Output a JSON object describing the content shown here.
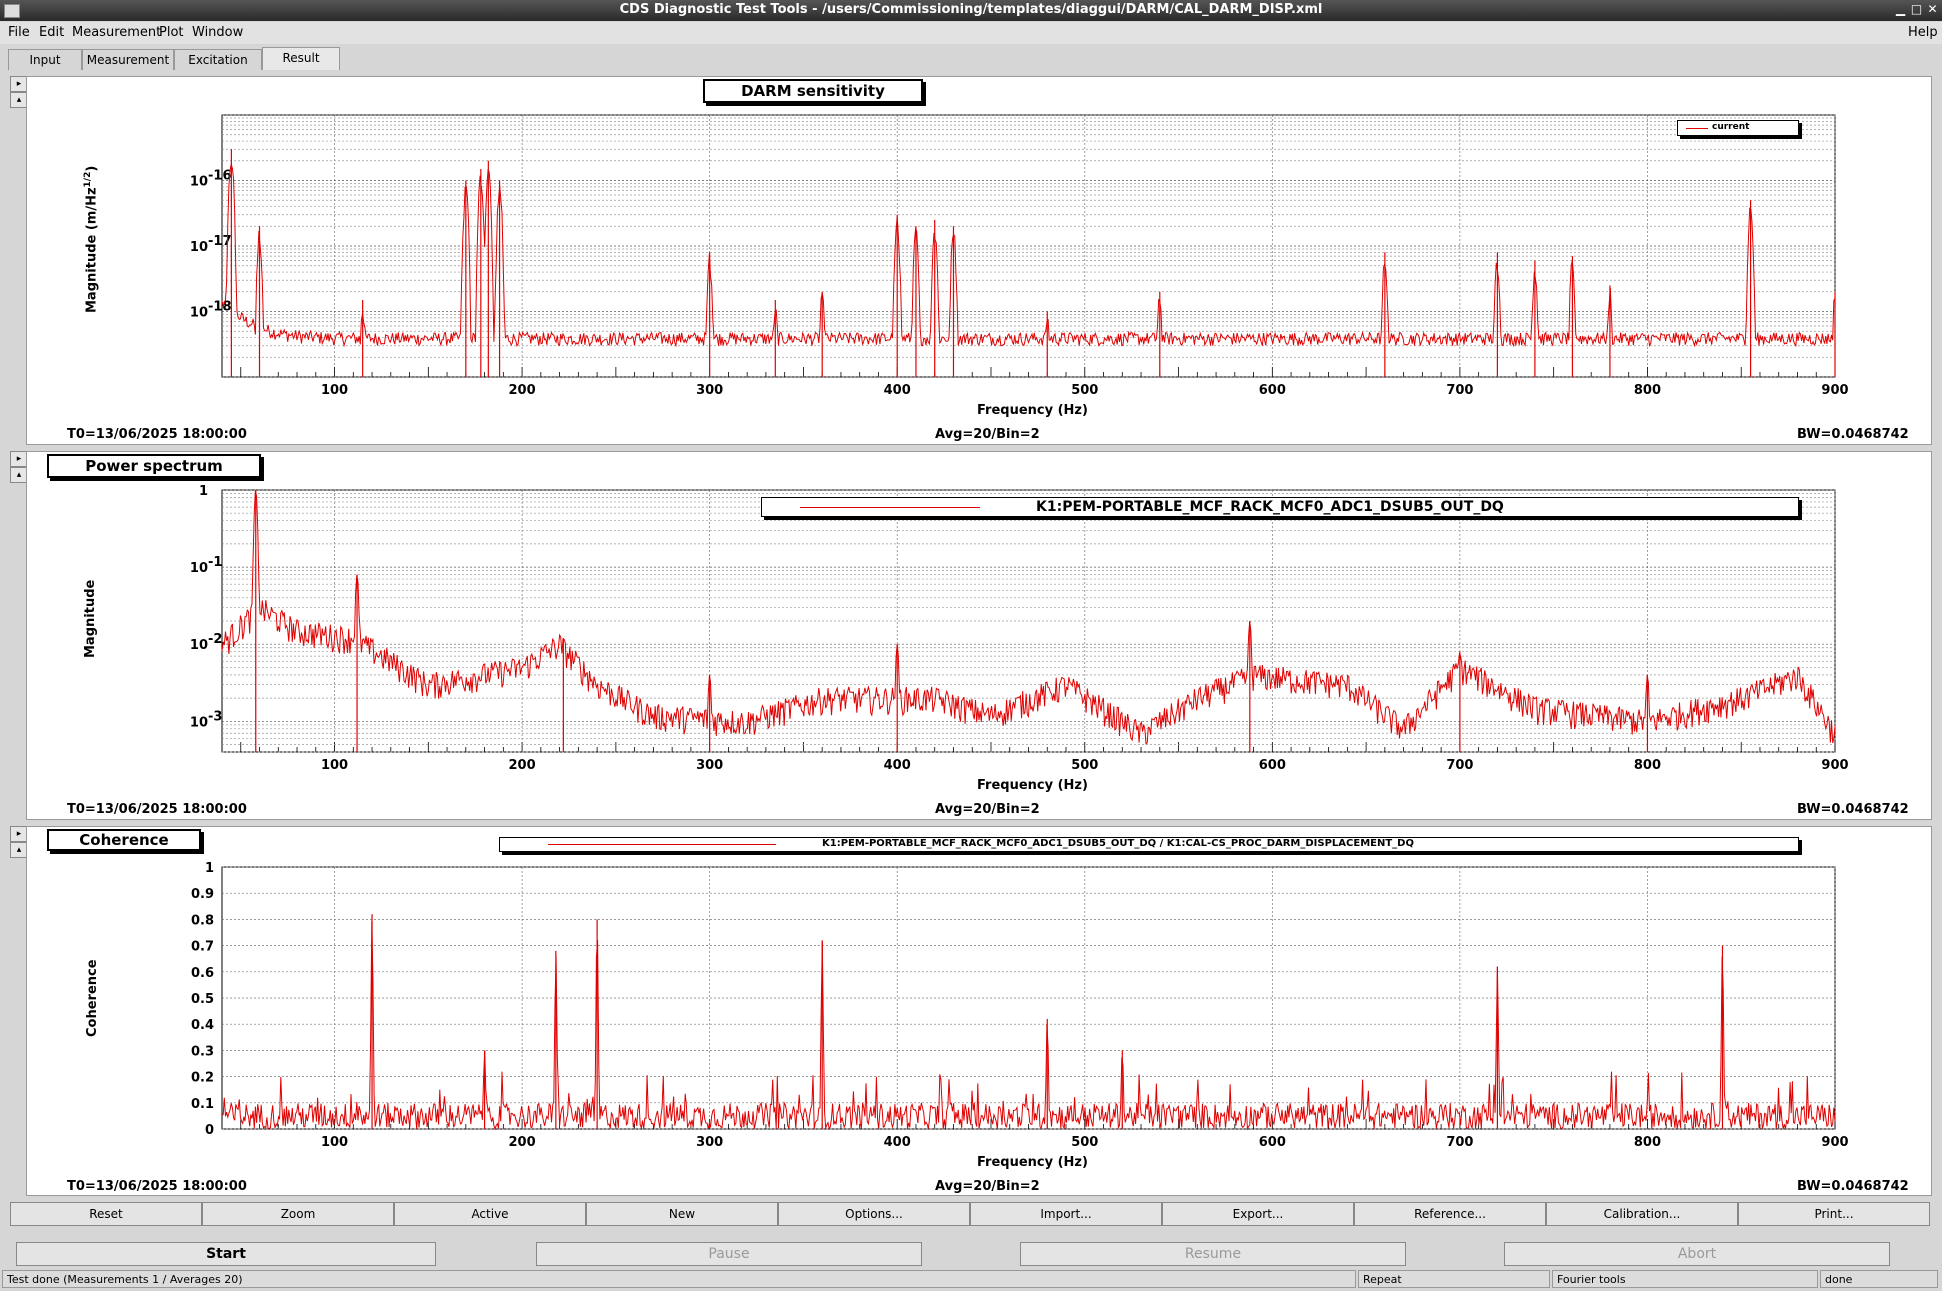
{
  "window": {
    "title": "CDS Diagnostic Test Tools - /users/Commissioning/templates/diaggui/DARM/CAL_DARM_DISP.xml"
  },
  "menu": {
    "items": [
      "File",
      "Edit",
      "Measurement",
      "Plot",
      "Window"
    ],
    "help": "Help"
  },
  "tabs": [
    "Input",
    "Measurement",
    "Excitation",
    "Result"
  ],
  "graphs": [
    {
      "title": "DARM sensitivity",
      "ylabel_main": "Magnitude (m/Hz",
      "ylabel_sup": "1/2",
      "ylabel_end": ")",
      "xlabel": "Frequency (Hz)",
      "legend": "current",
      "t0": "T0=13/06/2025 18:00:00",
      "avg": "Avg=20/Bin=2",
      "bw": "BW=0.0468742",
      "yticks": [
        {
          "base": "10",
          "exp": "-16"
        },
        {
          "base": "10",
          "exp": "-17"
        },
        {
          "base": "10",
          "exp": "-18"
        }
      ]
    },
    {
      "title": "Power spectrum",
      "ylabel_main": "Magnitude",
      "xlabel": "Frequency (Hz)",
      "legend": "K1:PEM-PORTABLE_MCF_RACK_MCF0_ADC1_DSUB5_OUT_DQ",
      "t0": "T0=13/06/2025 18:00:00",
      "avg": "Avg=20/Bin=2",
      "bw": "BW=0.0468742",
      "yticks": [
        {
          "base": "1",
          "exp": ""
        },
        {
          "base": "10",
          "exp": "-1"
        },
        {
          "base": "10",
          "exp": "-2"
        },
        {
          "base": "10",
          "exp": "-3"
        }
      ]
    },
    {
      "title": "Coherence",
      "ylabel_main": "Coherence",
      "xlabel": "Frequency (Hz)",
      "legend": "K1:PEM-PORTABLE_MCF_RACK_MCF0_ADC1_DSUB5_OUT_DQ / K1:CAL-CS_PROC_DARM_DISPLACEMENT_DQ",
      "t0": "T0=13/06/2025 18:00:00",
      "avg": "Avg=20/Bin=2",
      "bw": "BW=0.0468742",
      "yticks": [
        "1",
        "0.9",
        "0.8",
        "0.7",
        "0.6",
        "0.5",
        "0.4",
        "0.3",
        "0.2",
        "0.1",
        "0"
      ]
    }
  ],
  "xticks": [
    "100",
    "200",
    "300",
    "400",
    "500",
    "600",
    "700",
    "800",
    "900"
  ],
  "chart_data": [
    {
      "type": "line",
      "title": "DARM sensitivity",
      "xlabel": "Frequency (Hz)",
      "ylabel": "Magnitude (m/Hz^1/2)",
      "xlim": [
        40,
        900
      ],
      "ylim": [
        1e-19,
        1e-15
      ],
      "yscale": "log",
      "grid": true,
      "legend_position": "top-right",
      "series": [
        {
          "name": "current",
          "color": "#e00000",
          "baseline_floor": 3e-19,
          "peaks": [
            [
              45,
              3e-16
            ],
            [
              60,
              2e-17
            ],
            [
              115,
              1.5e-18
            ],
            [
              170,
              1e-16
            ],
            [
              178,
              1.5e-16
            ],
            [
              182,
              2e-16
            ],
            [
              188,
              1e-16
            ],
            [
              300,
              8e-18
            ],
            [
              335,
              1.5e-18
            ],
            [
              360,
              2e-18
            ],
            [
              400,
              3e-17
            ],
            [
              410,
              2e-17
            ],
            [
              420,
              2.5e-17
            ],
            [
              430,
              2e-17
            ],
            [
              480,
              1e-18
            ],
            [
              540,
              2e-18
            ],
            [
              660,
              8e-18
            ],
            [
              720,
              8e-18
            ],
            [
              740,
              6e-18
            ],
            [
              760,
              7e-18
            ],
            [
              780,
              2.5e-18
            ],
            [
              855,
              5e-17
            ],
            [
              900,
              2e-18
            ]
          ]
        }
      ]
    },
    {
      "type": "line",
      "title": "Power spectrum",
      "xlabel": "Frequency (Hz)",
      "ylabel": "Magnitude",
      "xlim": [
        40,
        900
      ],
      "ylim": [
        0.0004,
        1
      ],
      "yscale": "log",
      "grid": true,
      "legend_position": "top-right",
      "series": [
        {
          "name": "K1:PEM-PORTABLE_MCF_RACK_MCF0_ADC1_DSUB5_OUT_DQ",
          "color": "#e00000",
          "trend": [
            [
              40,
              0.01
            ],
            [
              60,
              0.03
            ],
            [
              80,
              0.015
            ],
            [
              110,
              0.012
            ],
            [
              150,
              0.003
            ],
            [
              200,
              0.005
            ],
            [
              220,
              0.01
            ],
            [
              240,
              0.003
            ],
            [
              270,
              0.0012
            ],
            [
              320,
              0.001
            ],
            [
              360,
              0.002
            ],
            [
              420,
              0.002
            ],
            [
              450,
              0.0012
            ],
            [
              490,
              0.003
            ],
            [
              530,
              0.0007
            ],
            [
              560,
              0.002
            ],
            [
              590,
              0.004
            ],
            [
              640,
              0.003
            ],
            [
              670,
              0.0008
            ],
            [
              700,
              0.005
            ],
            [
              740,
              0.0015
            ],
            [
              800,
              0.001
            ],
            [
              850,
              0.002
            ],
            [
              880,
              0.004
            ],
            [
              900,
              0.0007
            ]
          ],
          "peaks": [
            [
              58,
              1.0
            ],
            [
              112,
              0.08
            ],
            [
              222,
              0.012
            ],
            [
              300,
              0.004
            ],
            [
              400,
              0.01
            ],
            [
              588,
              0.02
            ],
            [
              700,
              0.008
            ],
            [
              800,
              0.004
            ]
          ]
        }
      ]
    },
    {
      "type": "line",
      "title": "Coherence",
      "xlabel": "Frequency (Hz)",
      "ylabel": "Coherence",
      "xlim": [
        40,
        900
      ],
      "ylim": [
        0,
        1
      ],
      "grid": true,
      "legend_position": "top",
      "series": [
        {
          "name": "K1:PEM-PORTABLE_MCF_RACK_MCF0_ADC1_DSUB5_OUT_DQ / K1:CAL-CS_PROC_DARM_DISPLACEMENT_DQ",
          "color": "#e00000",
          "noise_floor": 0.1,
          "peaks": [
            [
              120,
              0.82
            ],
            [
              180,
              0.3
            ],
            [
              218,
              0.68
            ],
            [
              240,
              0.8
            ],
            [
              360,
              0.72
            ],
            [
              480,
              0.42
            ],
            [
              520,
              0.3
            ],
            [
              720,
              0.62
            ],
            [
              840,
              0.7
            ]
          ]
        }
      ]
    }
  ],
  "buttons": [
    "Reset",
    "Zoom",
    "Active",
    "New",
    "Options...",
    "Import...",
    "Export...",
    "Reference...",
    "Calibration...",
    "Print..."
  ],
  "controls": [
    "Start",
    "Pause",
    "Resume",
    "Abort"
  ],
  "status": {
    "message": "Test done (Measurements 1 / Averages 20)",
    "repeat": "Repeat",
    "tools": "Fourier tools",
    "state": "done"
  },
  "colors": {
    "trace": "#e00000",
    "background": "#d6d6d6"
  }
}
